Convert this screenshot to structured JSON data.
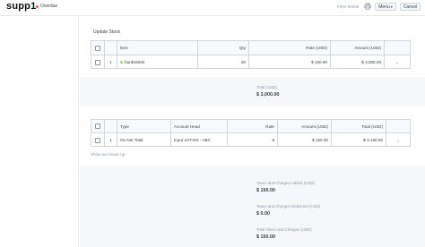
{
  "header": {
    "title": "supp1",
    "status": "Overdue",
    "doc_number": "PINV-00005",
    "menu_label": "Menu",
    "cancel_label": "Cancel",
    "status_color": "#ff5858"
  },
  "items_section": {
    "title": "Update Stock",
    "columns": [
      "Item",
      "Qty",
      "Rate (USD)",
      "Amount (USD)"
    ],
    "rows": [
      {
        "no": "1",
        "item": "hardisk002",
        "qty": "20",
        "rate": "$ 150.00",
        "amount": "$ 3,000.00"
      }
    ],
    "total_label": "Total (USD)",
    "total_value": "$ 3,000.00"
  },
  "taxes_section": {
    "columns": [
      "Type",
      "Account Head",
      "Rate",
      "Amount (USD)",
      "Total (USD)"
    ],
    "rows": [
      {
        "no": "1",
        "type": "On Net Total",
        "account_head": "Input VAT-5% - ABC",
        "rate": "5",
        "amount": "$ 150.00",
        "total": "$ 3,150.00"
      }
    ],
    "breakup_link": "Show tax break-up"
  },
  "summary": {
    "added_label": "Taxes and Charges Added (USD)",
    "added_value": "$ 150.00",
    "deducted_label": "Taxes and Charges Deducted (USD)",
    "deducted_value": "$ 0.00",
    "total_taxes_label": "Total Taxes and Charges (USD)",
    "total_taxes_value": "$ 150.00"
  },
  "icons": {
    "print": "printer-icon",
    "menu_caret": "caret-down-icon",
    "row_expand": "chevron-down-icon",
    "item_indicator": "status-dot-icon"
  }
}
